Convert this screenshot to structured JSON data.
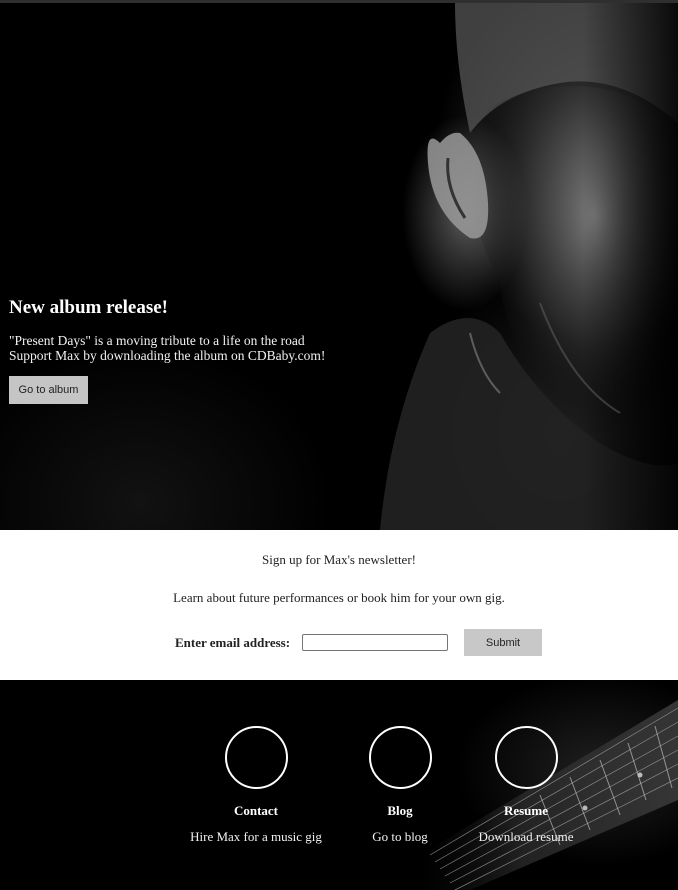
{
  "hero": {
    "title": "New album release!",
    "line1": "\"Present Days\" is a moving tribute to a life on the road",
    "line2": "Support Max by downloading the album on CDBaby.com!",
    "button_label": "Go to album"
  },
  "newsletter": {
    "heading": "Sign up for Max's newsletter!",
    "subtext": "Learn about future performances or book him for your own gig.",
    "email_label": "Enter email address:",
    "email_value": "",
    "submit_label": "Submit"
  },
  "footer": {
    "items": [
      {
        "title": "Contact",
        "link": "Hire Max for a music gig"
      },
      {
        "title": "Blog",
        "link": "Go to blog"
      },
      {
        "title": "Resume",
        "link": "Download resume"
      }
    ]
  }
}
